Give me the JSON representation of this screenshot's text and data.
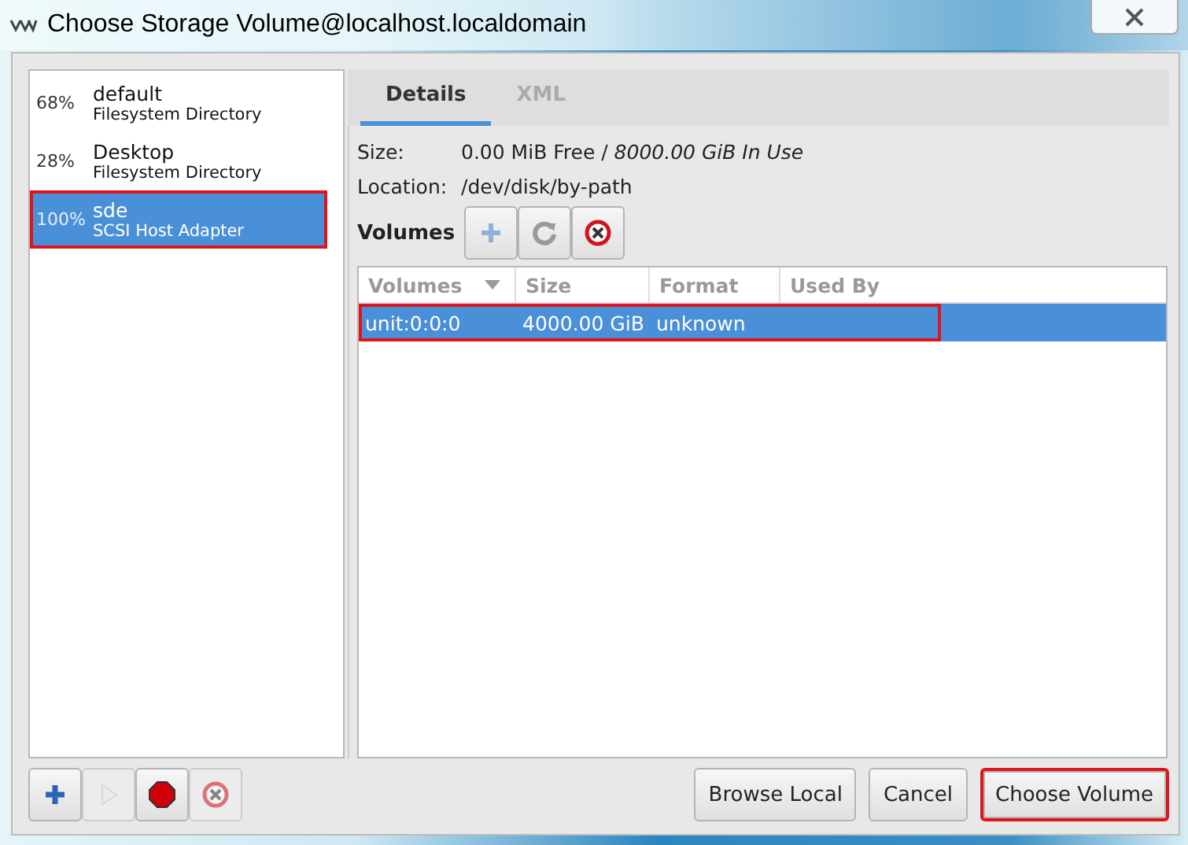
{
  "window": {
    "title": "Choose Storage Volume@localhost.localdomain"
  },
  "pools": [
    {
      "percent": "68%",
      "name": "default",
      "type": "Filesystem Directory",
      "selected": false,
      "highlighted": false
    },
    {
      "percent": "28%",
      "name": "Desktop",
      "type": "Filesystem Directory",
      "selected": false,
      "highlighted": false
    },
    {
      "percent": "100%",
      "name": "sde",
      "type": "SCSI Host Adapter",
      "selected": true,
      "highlighted": true
    }
  ],
  "pool_buttons": [
    {
      "kind": "add",
      "disabled": false
    },
    {
      "kind": "start",
      "disabled": true
    },
    {
      "kind": "stop",
      "disabled": false
    },
    {
      "kind": "delete",
      "disabled": true
    }
  ],
  "tabs": [
    {
      "label": "Details",
      "selected": true
    },
    {
      "label": "XML",
      "selected": false
    }
  ],
  "details": [
    {
      "label": "Size:",
      "value": "0.00 MiB Free / *8000.00 GiB In Use*"
    },
    {
      "label": "Location:",
      "value": "/dev/disk/by-path"
    }
  ],
  "volumes_label": "Volumes",
  "volume_buttons": [
    {
      "kind": "add",
      "disabled": false
    },
    {
      "kind": "refresh",
      "disabled": false
    },
    {
      "kind": "delete",
      "disabled": false
    }
  ],
  "table": {
    "columns": [
      {
        "label": "Volumes",
        "sorted": true
      },
      {
        "label": "Size",
        "sorted": false
      },
      {
        "label": "Format",
        "sorted": false
      },
      {
        "label": "Used By",
        "sorted": false
      }
    ],
    "rows": [
      {
        "cells": [
          "unit:0:0:0",
          "4000.00 GiB",
          "unknown"
        ],
        "selected": true,
        "highlighted": true
      }
    ]
  },
  "buttons": [
    {
      "label": "Browse Local",
      "highlighted": false
    },
    {
      "label": "Cancel",
      "highlighted": false
    },
    {
      "label": "Choose Volume",
      "highlighted": true
    }
  ]
}
